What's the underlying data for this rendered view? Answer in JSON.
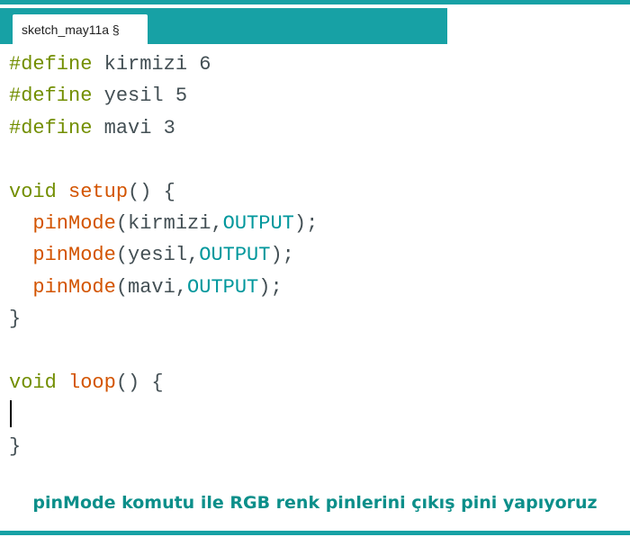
{
  "tab": {
    "label": "sketch_may11a §"
  },
  "code": {
    "line1": {
      "directive": "#define",
      "name": " kirmizi 6"
    },
    "line2": {
      "directive": "#define",
      "name": " yesil 5"
    },
    "line3": {
      "directive": "#define",
      "name": " mavi 3"
    },
    "line5": {
      "type": "void",
      "func": "setup",
      "rest": "() {"
    },
    "line6": {
      "indent": "  ",
      "func": "pinMode",
      "open": "(kirmizi,",
      "const": "OUTPUT",
      "close": ");"
    },
    "line7": {
      "indent": "  ",
      "func": "pinMode",
      "open": "(yesil,",
      "const": "OUTPUT",
      "close": ");"
    },
    "line8": {
      "indent": "  ",
      "func": "pinMode",
      "open": "(mavi,",
      "const": "OUTPUT",
      "close": ");"
    },
    "line9": {
      "text": "}"
    },
    "line11": {
      "type": "void",
      "func": "loop",
      "rest": "() {"
    },
    "line13": {
      "text": "}"
    }
  },
  "caption": "pinMode komutu ile RGB renk pinlerini çıkış pini yapıyoruz",
  "colors": {
    "accent": "#17a1a5",
    "caption": "#0c8f8a",
    "keyword": "#728e00",
    "function": "#d35400",
    "constant": "#00979c",
    "text": "#434f54"
  }
}
